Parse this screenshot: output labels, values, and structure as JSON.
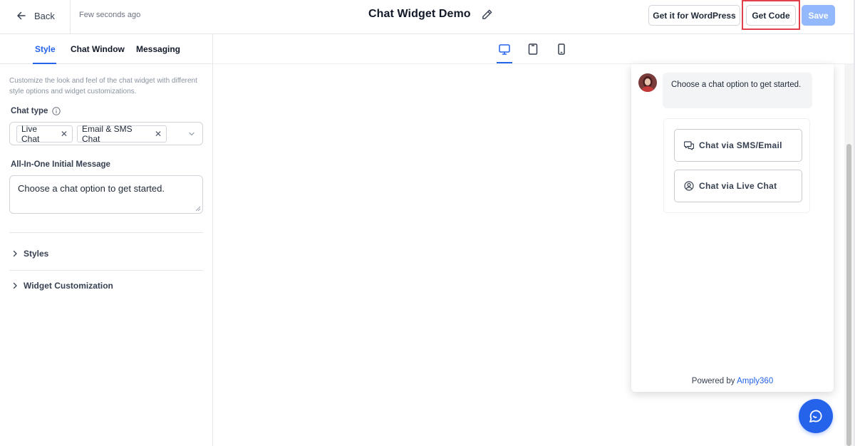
{
  "header": {
    "back_label": "Back",
    "saved_status": "Few seconds ago",
    "title": "Chat Widget Demo",
    "wordpress_label": "Get it for WordPress",
    "get_code_label": "Get Code",
    "save_label": "Save"
  },
  "tabs": [
    {
      "label": "Style",
      "active": true
    },
    {
      "label": "Chat Window",
      "active": false
    },
    {
      "label": "Messaging",
      "active": false
    }
  ],
  "style_panel": {
    "description": "Customize the look and feel of the chat widget with different style options and widget customizations.",
    "chat_type": {
      "label": "Chat type",
      "selected": [
        "Live Chat",
        "Email & SMS Chat"
      ]
    },
    "initial_message": {
      "label": "All-In-One Initial Message",
      "value": "Choose a chat option to get started."
    },
    "sections": [
      "Styles",
      "Widget Customization"
    ]
  },
  "devices": {
    "active": "desktop",
    "items": [
      "desktop",
      "tablet",
      "mobile"
    ]
  },
  "widget": {
    "bubble_text": "Choose a chat option to get started.",
    "options": [
      "Chat via SMS/Email",
      "Chat via Live Chat"
    ],
    "powered_prefix": "Powered by",
    "powered_brand": "Amply360"
  },
  "colors": {
    "accent": "#2563eb",
    "save_disabled": "#93b8fb",
    "highlight": "#e0414d"
  }
}
